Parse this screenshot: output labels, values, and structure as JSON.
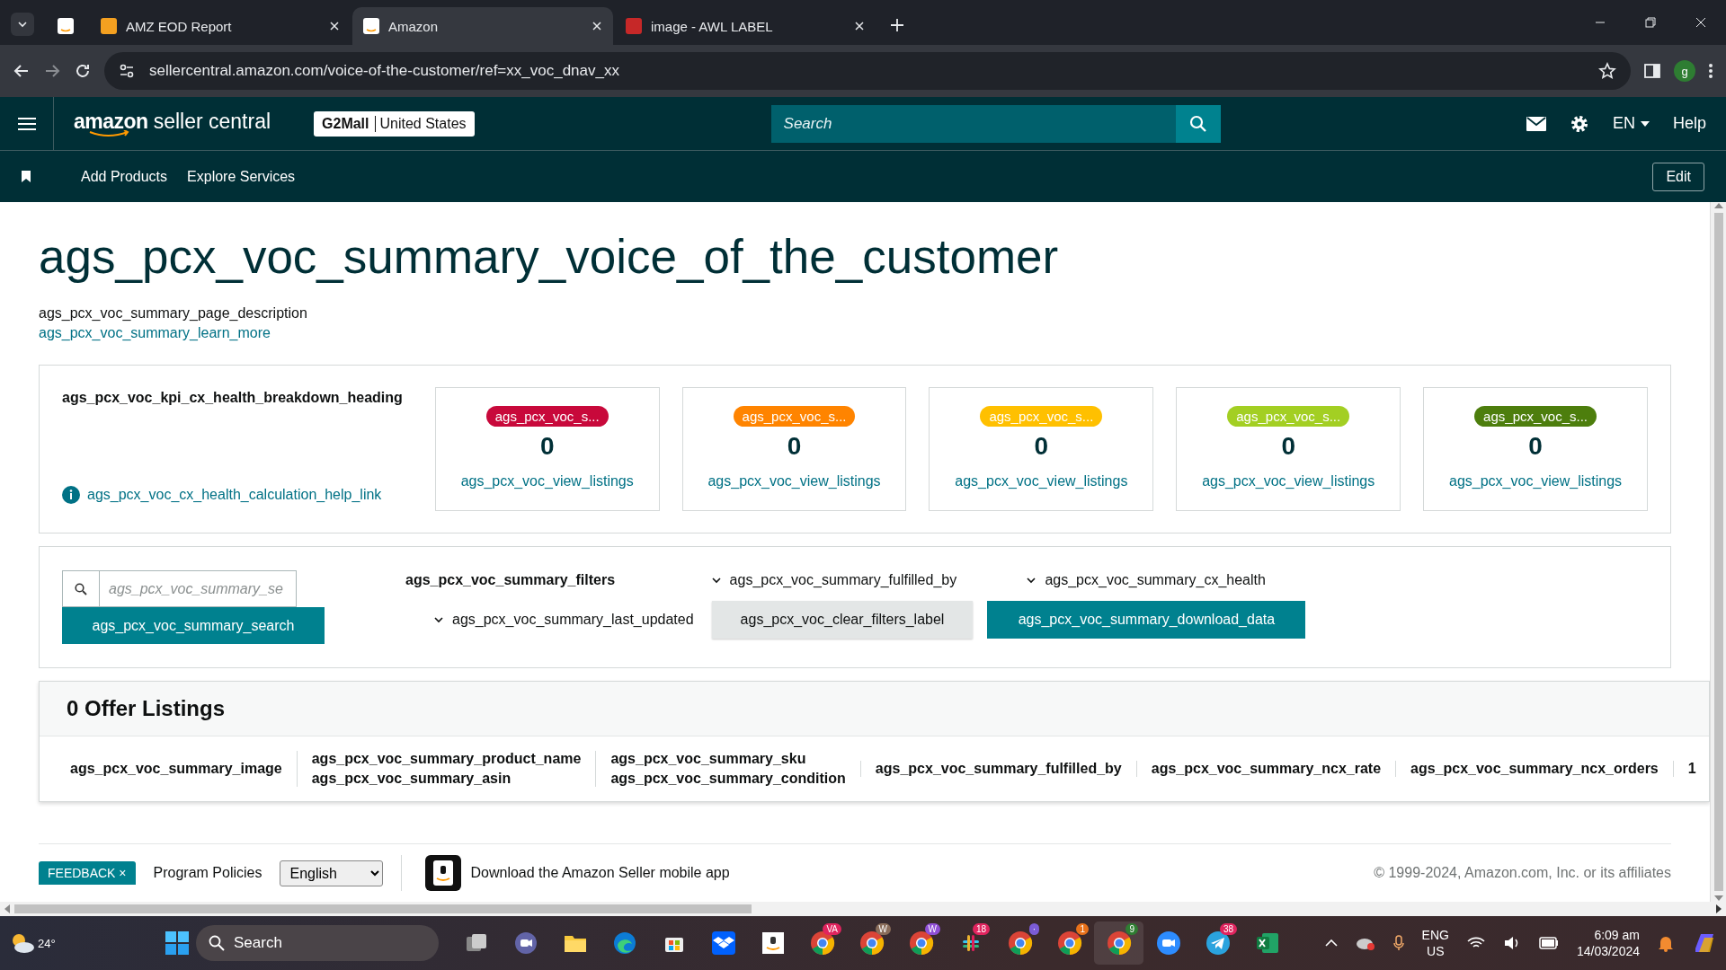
{
  "browser": {
    "tabs": [
      {
        "kind": "pinned",
        "selected": false
      },
      {
        "kind": "page",
        "title": "AMZ EOD Report",
        "selected": false
      },
      {
        "kind": "page",
        "title": "Amazon",
        "selected": true
      },
      {
        "kind": "page",
        "title": "image - AWL LABEL",
        "selected": false
      }
    ],
    "url": "sellercentral.amazon.com/voice-of-the-customer/ref=xx_voc_dnav_xx",
    "profile": "g"
  },
  "header": {
    "brand": "amazon",
    "product": "seller central",
    "store": "G2Mall",
    "region": "United States",
    "search_placeholder": "Search",
    "language": "EN",
    "help": "Help"
  },
  "subnav": {
    "items": [
      "Add Products",
      "Explore Services"
    ],
    "edit": "Edit"
  },
  "page": {
    "title": "ags_pcx_voc_summary_voice_of_the_customer",
    "description": "ags_pcx_voc_summary_page_description",
    "learn_more": "ags_pcx_voc_summary_learn_more"
  },
  "kpi": {
    "heading": "ags_pcx_voc_kpi_cx_health_breakdown_heading",
    "help_link": "ags_pcx_voc_cx_health_calculation_help_link",
    "cards": [
      {
        "badge": "ags_pcx_voc_s...",
        "color": "#c8093b",
        "count": "0",
        "link": "ags_pcx_voc_view_listings"
      },
      {
        "badge": "ags_pcx_voc_s...",
        "color": "#ff8400",
        "count": "0",
        "link": "ags_pcx_voc_view_listings"
      },
      {
        "badge": "ags_pcx_voc_s...",
        "color": "#ffc000",
        "count": "0",
        "link": "ags_pcx_voc_view_listings"
      },
      {
        "badge": "ags_pcx_voc_s...",
        "color": "#a3cf23",
        "count": "0",
        "link": "ags_pcx_voc_view_listings"
      },
      {
        "badge": "ags_pcx_voc_s...",
        "color": "#4d7e0d",
        "count": "0",
        "link": "ags_pcx_voc_view_listings"
      }
    ]
  },
  "filters": {
    "search_placeholder": "ags_pcx_voc_summary_se",
    "search_button": "ags_pcx_voc_summary_search",
    "label": "ags_pcx_voc_summary_filters",
    "dropdowns": [
      "ags_pcx_voc_summary_fulfilled_by",
      "ags_pcx_voc_summary_cx_health",
      "ags_pcx_voc_summary_last_updated"
    ],
    "clear": "ags_pcx_voc_clear_filters_label",
    "download": "ags_pcx_voc_summary_download_data"
  },
  "listings": {
    "title": "0 Offer Listings",
    "columns": [
      [
        "ags_pcx_voc_summary_image"
      ],
      [
        "ags_pcx_voc_summary_product_name",
        "ags_pcx_voc_summary_asin"
      ],
      [
        "ags_pcx_voc_summary_sku",
        "ags_pcx_voc_summary_condition"
      ],
      [
        "ags_pcx_voc_summary_fulfilled_by"
      ],
      [
        "ags_pcx_voc_summary_ncx_rate"
      ],
      [
        "ags_pcx_voc_summary_ncx_orders"
      ],
      [
        "1"
      ]
    ]
  },
  "footer": {
    "feedback": "FEEDBACK",
    "close": "×",
    "links": [
      "Program Policies"
    ],
    "language": "English",
    "app_text": "Download the Amazon Seller mobile app",
    "copyright": "© 1999-2024, Amazon.com, Inc. or its affiliates"
  },
  "taskbar": {
    "weather": "24°",
    "search": "Search",
    "apps": [
      {
        "kind": "taskview"
      },
      {
        "kind": "teams"
      },
      {
        "kind": "folder"
      },
      {
        "kind": "edge"
      },
      {
        "kind": "store"
      },
      {
        "kind": "dropbox"
      },
      {
        "kind": "amazon"
      },
      {
        "kind": "chrome",
        "badge": "VA",
        "color": "#e0245e"
      },
      {
        "kind": "chrome",
        "badge": "W",
        "color": "#8a6d5a"
      },
      {
        "kind": "chrome",
        "badge": "W",
        "color": "#8f4fd6"
      },
      {
        "kind": "slack",
        "badge": "18",
        "color": "#e0245e"
      },
      {
        "kind": "chrome",
        "badge": "·",
        "color": "#7b5cd6"
      },
      {
        "kind": "chrome",
        "badge": "1",
        "color": "#e8711a"
      },
      {
        "kind": "chrome",
        "badge": "9",
        "color": "#2f7d32"
      },
      {
        "kind": "zoom"
      },
      {
        "kind": "telegram",
        "badge": "38",
        "color": "#e0245e"
      },
      {
        "kind": "excel"
      }
    ],
    "lang": "ENG",
    "region": "US",
    "time": "6:09 am",
    "date": "14/03/2024"
  }
}
